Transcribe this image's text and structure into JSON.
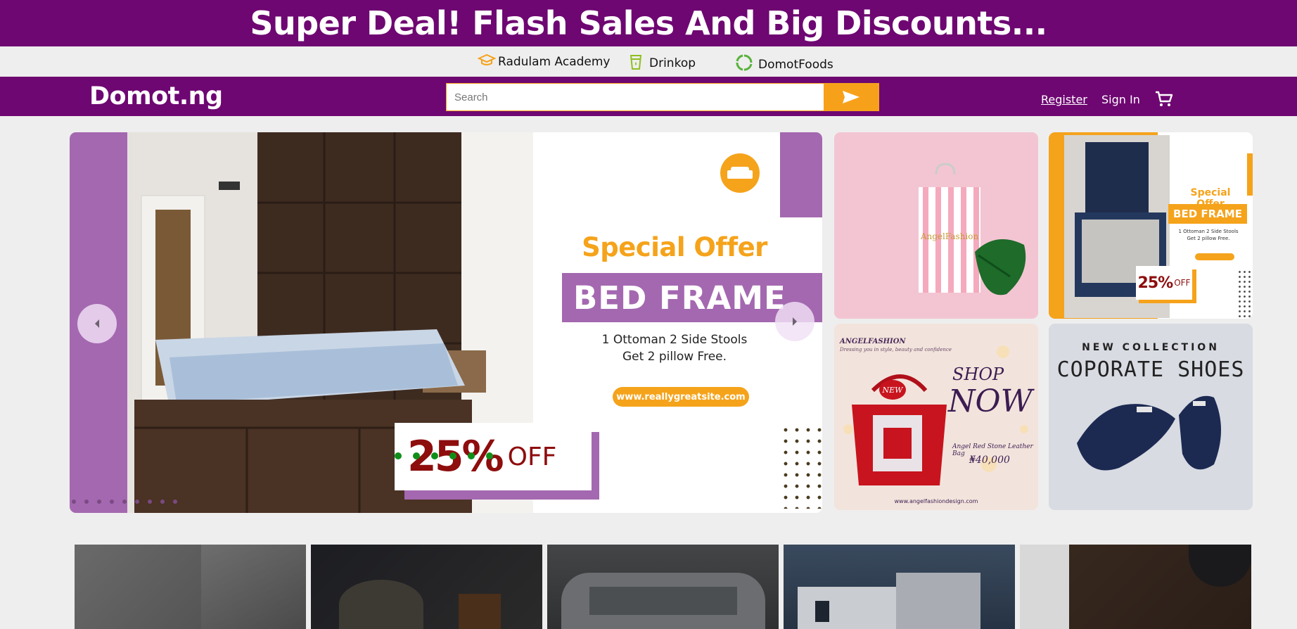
{
  "topbar": {
    "headline": "Super Deal! Flash Sales And Big Discounts..."
  },
  "partners": [
    {
      "label": "Radulam Academy",
      "icon": "graduation-cap-icon"
    },
    {
      "label": "Drinkop",
      "icon": "cup-icon"
    },
    {
      "label": "DomotFoods",
      "icon": "circle-arrows-icon"
    }
  ],
  "nav": {
    "logo": "Domot.ng",
    "search_placeholder": "Search",
    "register": "Register",
    "sign_in": "Sign In",
    "cart_icon": "cart-icon"
  },
  "hero": {
    "special_offer": "Special Offer",
    "bed_frame": "BED FRAME",
    "line1": "1 Ottoman 2 Side Stools",
    "line2": "Get 2 pillow Free.",
    "site": "www.reallygreatsite.com",
    "discount": "25%",
    "off": "OFF",
    "slide_count": 9,
    "colors": {
      "purple": "#a468b0",
      "orange": "#f5a31b",
      "red": "#8e0d0d"
    }
  },
  "tiles": {
    "shopping_bag": {
      "brand": "AngelFashion"
    },
    "bed_offer": {
      "special_offer": "Special Offer",
      "bed_frame": "BED FRAME",
      "line1": "1 Ottoman 2 Side Stools",
      "line2": "Get 2 pillow Free.",
      "discount": "25%",
      "off": "OFF"
    },
    "shop_now": {
      "brand": "ANGELFASHION",
      "tagline": "Dressing you in style, beauty and confidence",
      "shop": "SHOP",
      "now": "NOW",
      "new_tag": "NEW",
      "product": "Angel Red Stone Leather Bag",
      "price": "₦40,000",
      "site": "www.angelfashiondesign.com"
    },
    "shoes": {
      "heading": "NEW COLLECTION",
      "title": "COPORATE SHOES"
    }
  },
  "brand_colors": {
    "purple": "#6e0772",
    "orange": "#f7a11b",
    "background": "#eeeeee"
  }
}
